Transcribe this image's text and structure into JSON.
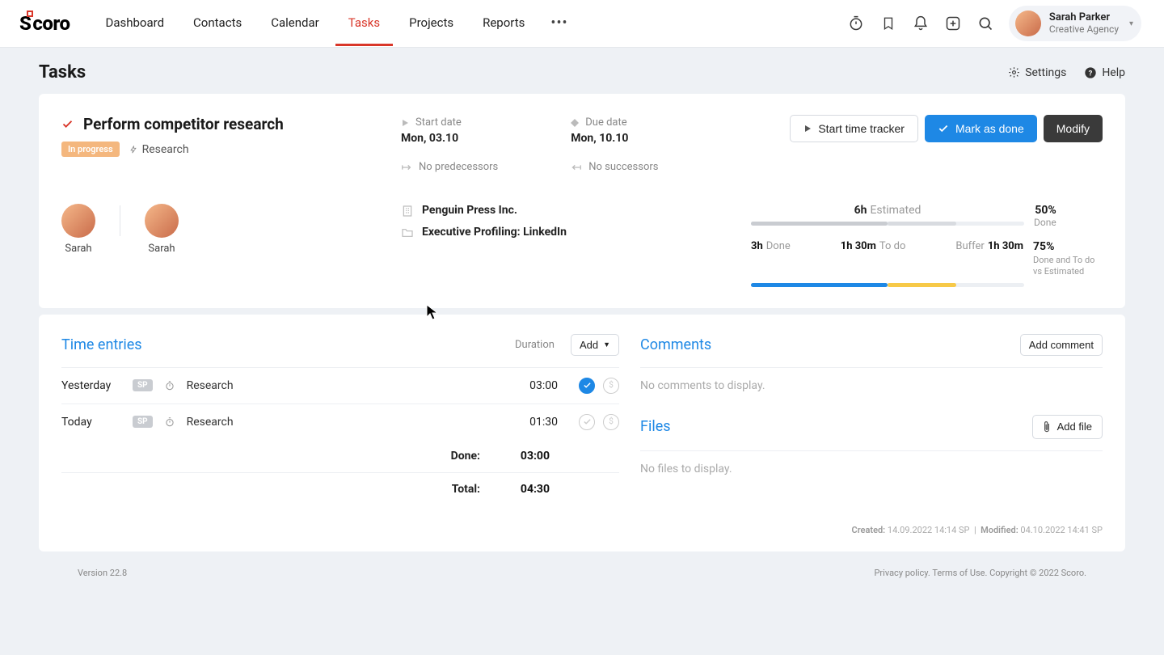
{
  "nav": {
    "brand": "Scoro",
    "items": [
      "Dashboard",
      "Contacts",
      "Calendar",
      "Tasks",
      "Projects",
      "Reports"
    ],
    "active_index": 3,
    "user": {
      "name": "Sarah Parker",
      "org": "Creative Agency"
    }
  },
  "page": {
    "title": "Tasks",
    "settings": "Settings",
    "help": "Help"
  },
  "task": {
    "title": "Perform competitor research",
    "status_badge": "In progress",
    "activity_type": "Research",
    "start": {
      "label": "Start date",
      "value": "Mon, 03.10"
    },
    "due": {
      "label": "Due date",
      "value": "Mon, 10.10"
    },
    "no_predecessors": "No predecessors",
    "no_successors": "No successors",
    "buttons": {
      "start_tracker": "Start time tracker",
      "mark_done": "Mark as done",
      "modify": "Modify"
    },
    "assignees": [
      "Sarah",
      "Sarah"
    ],
    "company": "Penguin Press Inc.",
    "project": "Executive Profiling: LinkedIn",
    "stats": {
      "estimated_value": "6h",
      "estimated_label": "Estimated",
      "done_percent": "50%",
      "done_percent_label": "Done",
      "done_value": "3h",
      "done_label": "Done",
      "todo_value": "1h 30m",
      "todo_label": "To do",
      "buffer_label": "Buffer",
      "buffer_value": "1h 30m",
      "ratio_percent": "75%",
      "ratio_label": "Done and To do vs Estimated"
    }
  },
  "time_entries": {
    "title": "Time entries",
    "duration_label": "Duration",
    "add_label": "Add",
    "rows": [
      {
        "day": "Yesterday",
        "badge": "SP",
        "activity": "Research",
        "duration": "03:00",
        "done": true
      },
      {
        "day": "Today",
        "badge": "SP",
        "activity": "Research",
        "duration": "01:30",
        "done": false
      }
    ],
    "done_label": "Done:",
    "done_value": "03:00",
    "total_label": "Total:",
    "total_value": "04:30"
  },
  "comments": {
    "title": "Comments",
    "add_label": "Add comment",
    "empty": "No comments to display."
  },
  "files": {
    "title": "Files",
    "add_label": "Add file",
    "empty": "No files to display."
  },
  "audit": {
    "created_label": "Created:",
    "created_value": "14.09.2022 14:14 SP",
    "modified_label": "Modified:",
    "modified_value": "04.10.2022 14:41 SP"
  },
  "footer": {
    "version": "Version 22.8",
    "legal": "Privacy policy. Terms of Use. Copyright © 2022 Scoro."
  }
}
